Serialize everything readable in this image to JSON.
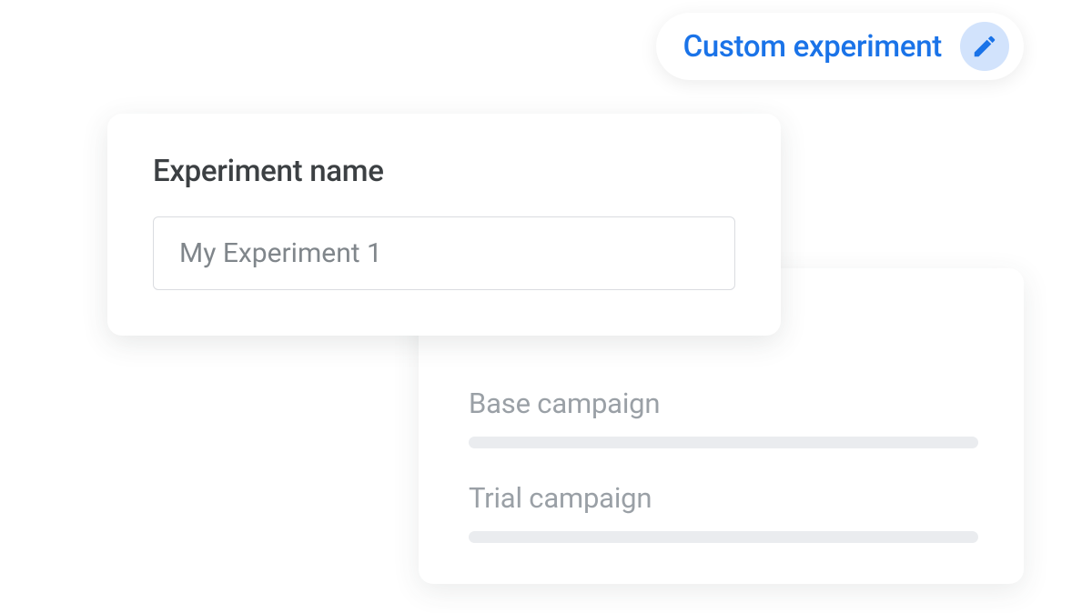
{
  "header": {
    "title": "Custom experiment",
    "icon": "pencil-icon"
  },
  "nameCard": {
    "title": "Experiment name",
    "inputValue": "My Experiment 1"
  },
  "campaignCard": {
    "rows": [
      {
        "label": "Base campaign"
      },
      {
        "label": "Trial campaign"
      }
    ]
  },
  "colors": {
    "accent": "#1a73e8",
    "iconBg": "#d2e3fc",
    "text": "#3c4043",
    "muted": "#9aa0a6",
    "placeholder": "#eaecef",
    "border": "#dadce0"
  }
}
